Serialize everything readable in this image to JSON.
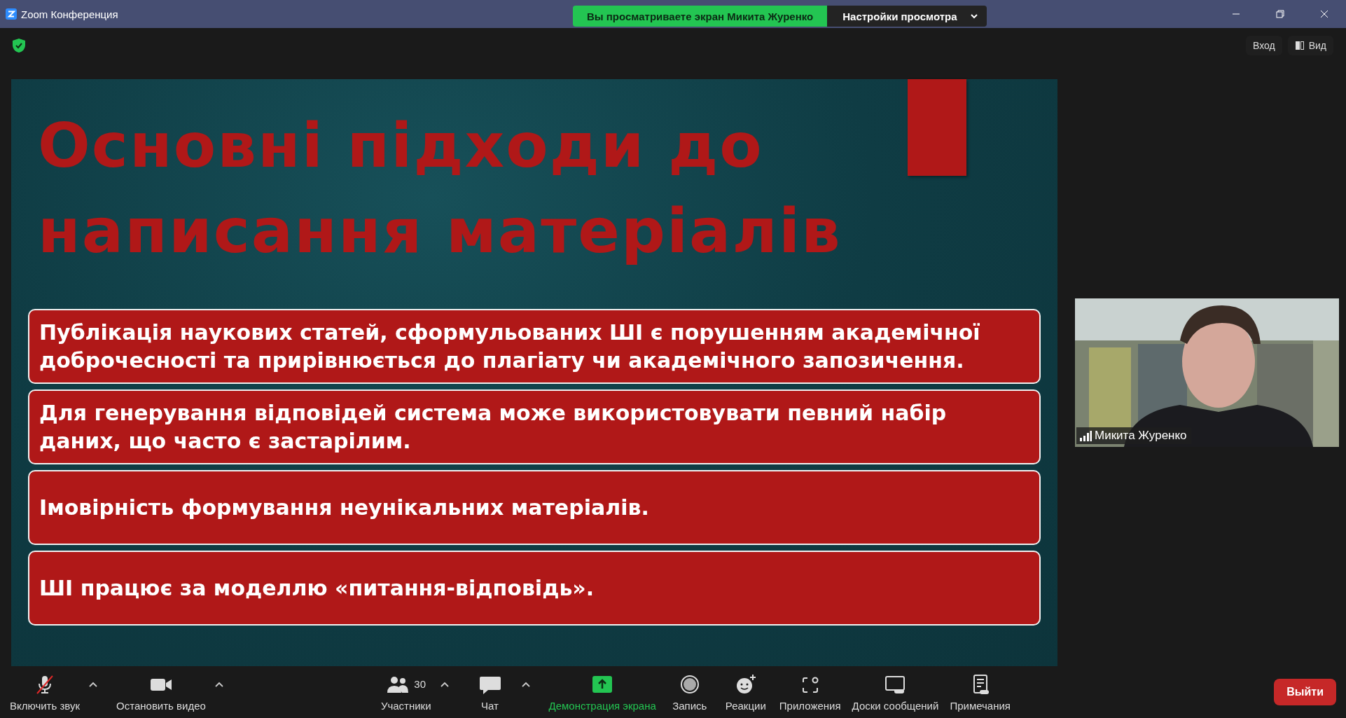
{
  "window": {
    "title": "Zoom Конференция"
  },
  "share_banner": {
    "text": "Вы просматриваете экран Микита Журенко",
    "menu": "Настройки просмотра"
  },
  "top_bar": {
    "buttons": [
      {
        "label": "Вход",
        "kind": "plain"
      },
      {
        "label": "Вид",
        "kind": "view"
      }
    ]
  },
  "slide": {
    "title_lines": [
      "Основні підходи до",
      "написання матеріалів"
    ],
    "points": [
      "Публікація наукових статей, сформульованих ШІ є порушенням академічної доброчесності та прирівнюється до плагіату чи академічного запозичення.",
      "Для генерування відповідей система може використовувати певний набір даних, що часто є застарілим.",
      "Імовірність формування неунікальних матеріалів.",
      "ШІ працює за моделлю «питання-відповідь»."
    ]
  },
  "video": {
    "name": "Микита Журенко",
    "kind": "picture"
  },
  "toolbar": {
    "left": [
      {
        "kind": "mic",
        "label": "Включить звук",
        "muted": true,
        "caret": true
      },
      {
        "kind": "camera",
        "label": "Остановить видео",
        "caret": true
      }
    ],
    "center": [
      {
        "kind": "participants",
        "label": "Участники",
        "count": "30",
        "caret": true
      },
      {
        "kind": "chat",
        "label": "Чат",
        "caret": true
      },
      {
        "kind": "share",
        "label": "Демонстрация экрана",
        "caret": false
      },
      {
        "kind": "record",
        "label": "Запись",
        "caret": false
      },
      {
        "kind": "reactions",
        "label": "Реакции",
        "caret": false
      },
      {
        "kind": "apps",
        "label": "Приложения",
        "caret": false
      },
      {
        "kind": "whiteboard",
        "label": "Доски сообщений",
        "caret": false
      },
      {
        "kind": "notes",
        "label": "Примечания",
        "caret": false
      }
    ],
    "leave": "Выйти"
  }
}
